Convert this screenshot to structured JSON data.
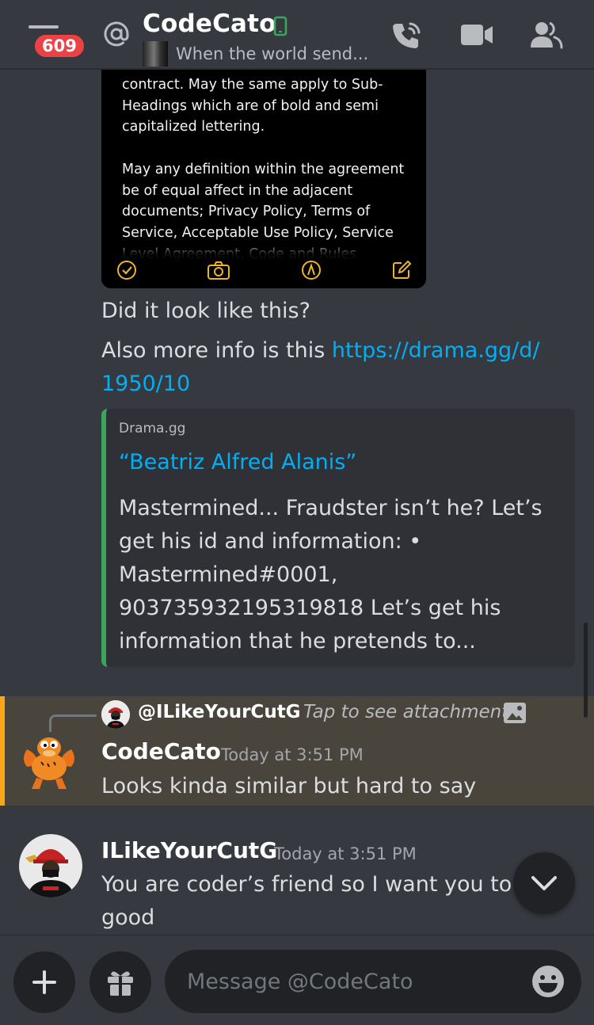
{
  "header": {
    "notification_count": "609",
    "title": "CodeCato",
    "status_text": "When the world send...",
    "icons": [
      "hamburger-icon",
      "at-icon",
      "mobile-status-icon",
      "phone-call-icon",
      "video-call-icon",
      "members-icon"
    ]
  },
  "embedded_image": {
    "text": "contract. May the same apply to Sub-\nHeadings which are of bold and semi\ncapitalized lettering.\n\n May any definition within the agreement\nbe of equal affect in the adjacent\ndocuments; Privacy Policy, Terms of\nService, Acceptable Use Policy, Service\nLevel Agreement, Code and Rules",
    "toolbar_icons": [
      "checkmark-icon",
      "camera-icon",
      "markup-pen-icon",
      "compose-icon"
    ]
  },
  "messages": {
    "text1": "Did it look like this?",
    "text2_prefix": "Also more info is this ",
    "text2_link_line1": "https://drama.gg/d/",
    "text2_link_line2": "1950/10"
  },
  "link_embed": {
    "provider": "Drama.gg",
    "title": "“Beatriz Alfred Alanis”",
    "description": "Mastermined... Fraudster isn’t he? Let’s get his id and information: • Mastermined#0001, 903735932195319818 Let’s get his information that he pretends to...",
    "accent_color": "#3ba55c"
  },
  "reply_message": {
    "reply_to": "@ILikeYourCutG",
    "reply_hint": "Tap to see attachment",
    "author": "CodeCato",
    "timestamp": "Today at 3:51 PM",
    "text": "Looks kinda similar but hard to say",
    "highlight_color": "#faa61a"
  },
  "last_message": {
    "author": "ILikeYourCutG",
    "timestamp": "Today at 3:51 PM",
    "text": "You are coder’s friend so I want you to be",
    "text_line2": "good"
  },
  "composer": {
    "placeholder": "Message @CodeCato",
    "buttons": [
      "plus-icon",
      "gift-icon",
      "emoji-icon"
    ]
  },
  "jump_button_icon": "chevron-down-icon"
}
